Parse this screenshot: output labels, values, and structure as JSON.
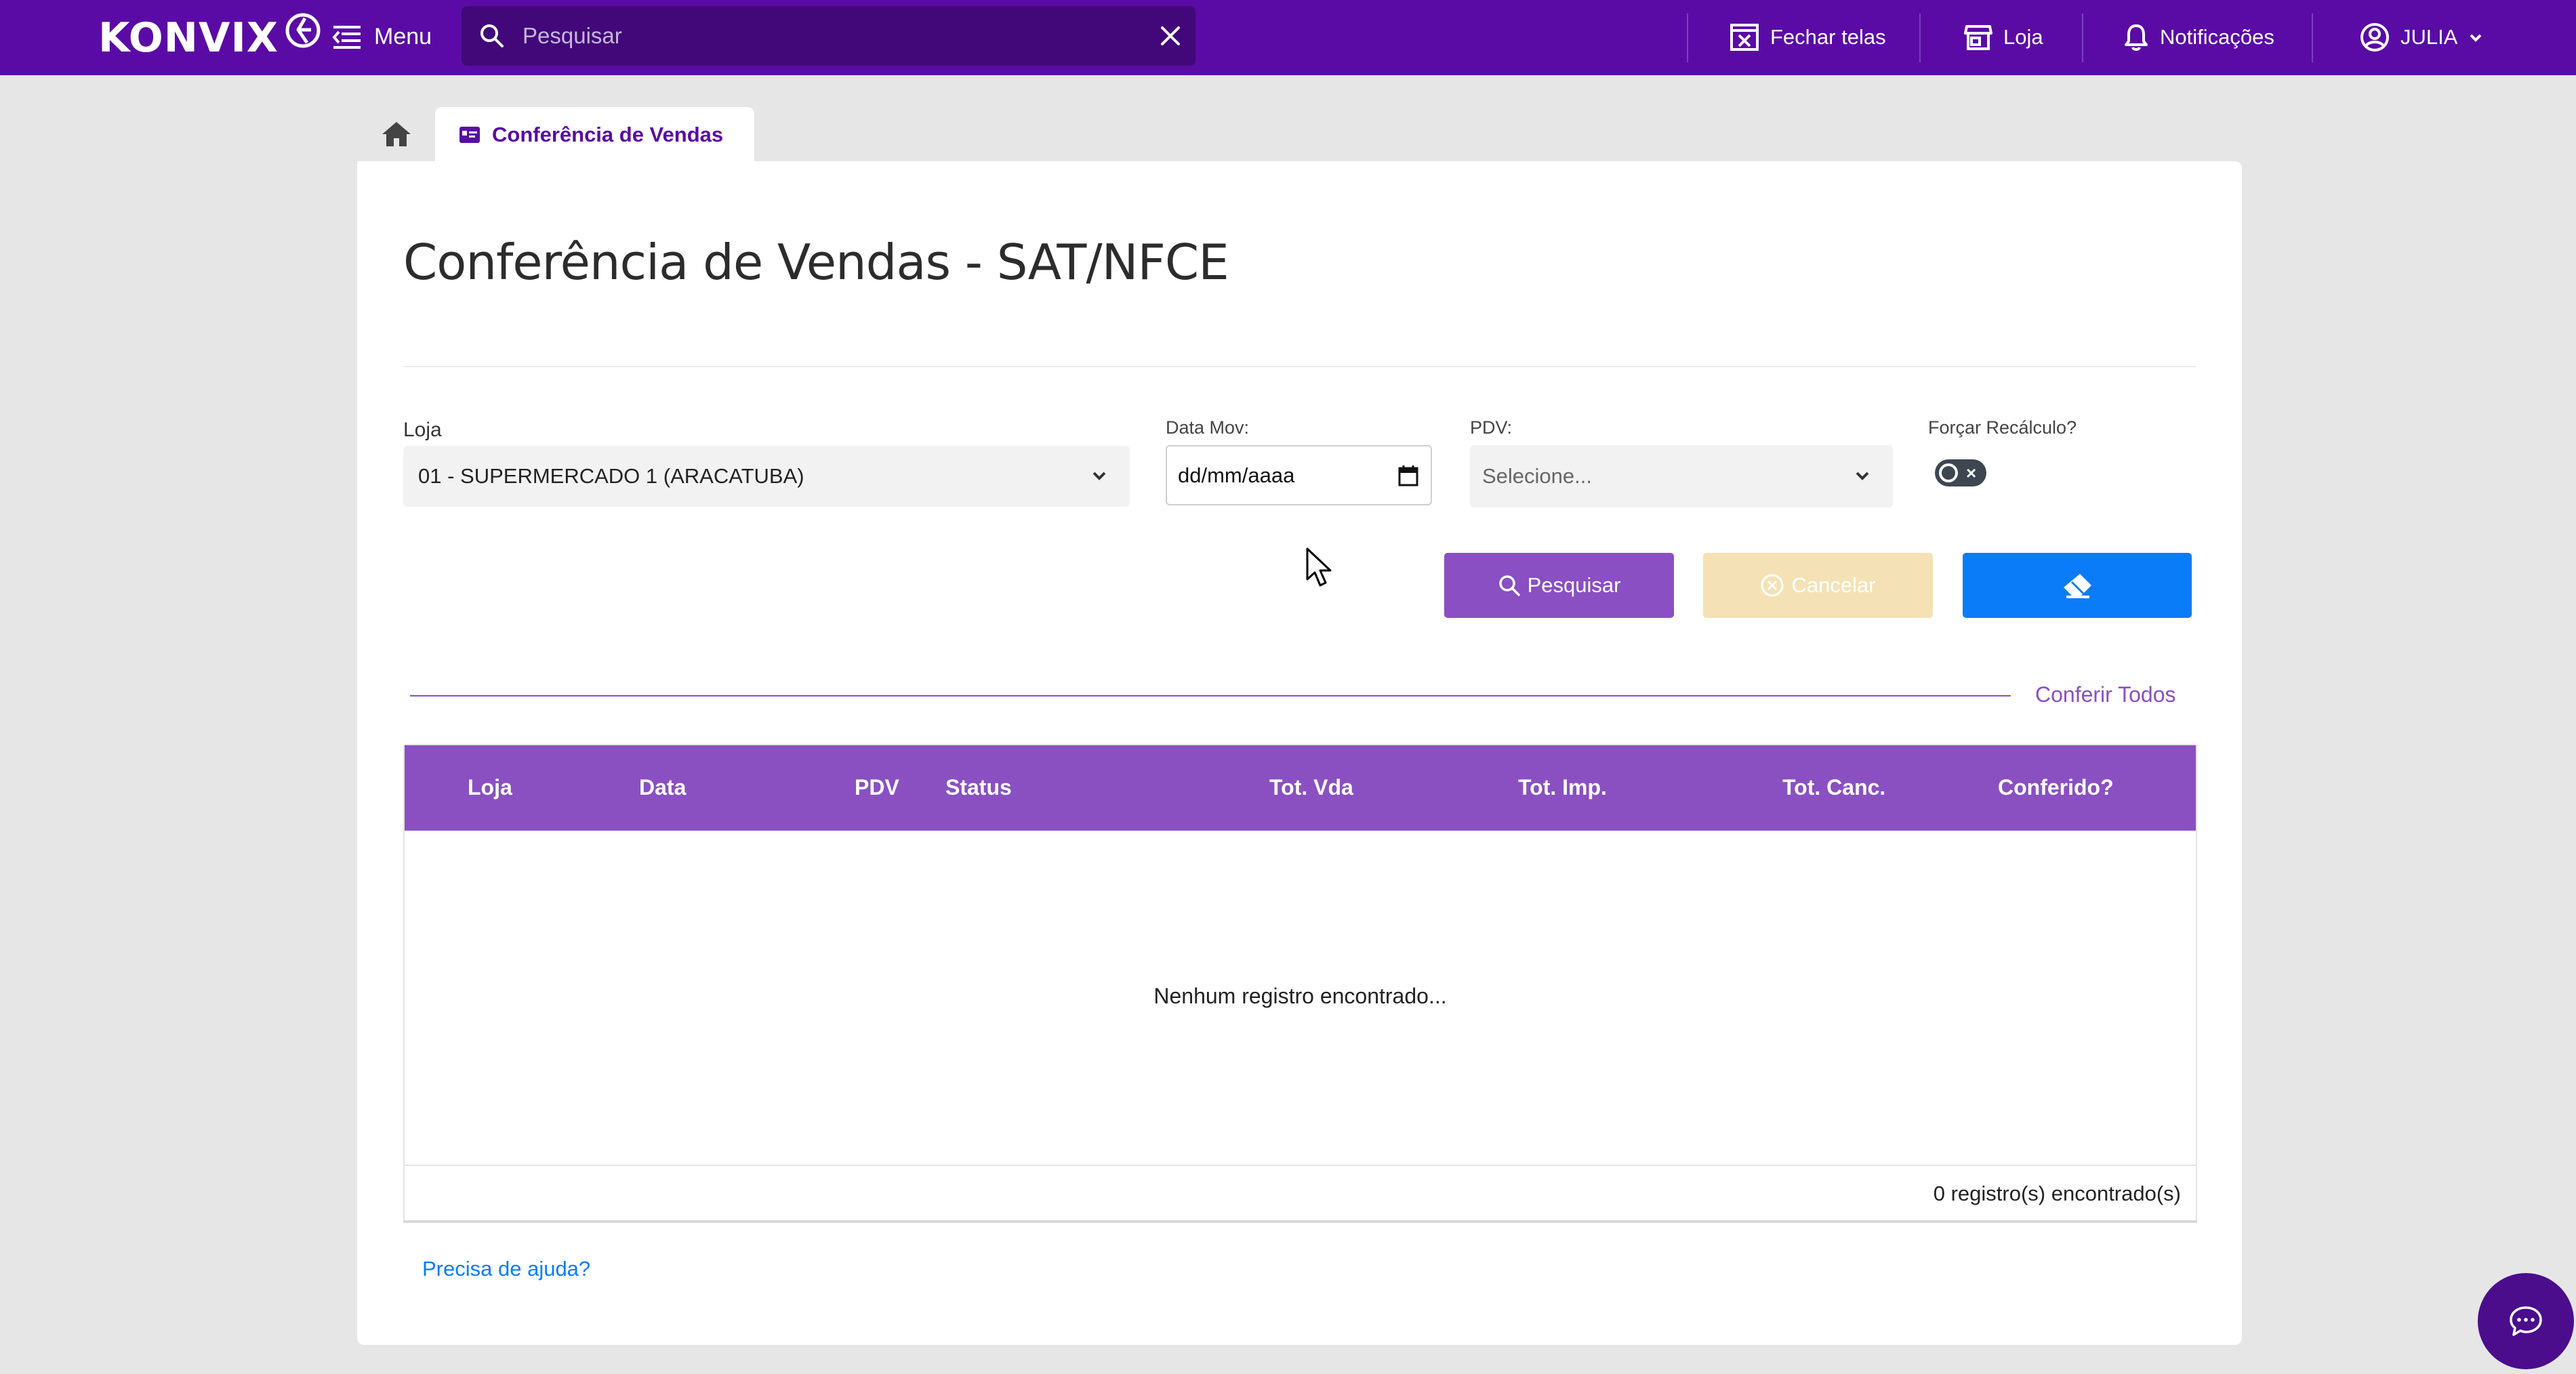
{
  "topbar": {
    "logo_text": "KONVIX",
    "menu_label": "Menu",
    "search_placeholder": "Pesquisar",
    "search_value": "",
    "close_screens_label": "Fechar telas",
    "store_label": "Loja",
    "notifications_label": "Notificações",
    "user_label": "JULIA"
  },
  "tabs": {
    "active_label": "Conferência de Vendas"
  },
  "page": {
    "title": "Conferência de Vendas - SAT/NFCE"
  },
  "form": {
    "loja_label": "Loja",
    "loja_value": "01 - SUPERMERCADO 1 (ARACATUBA)",
    "data_label": "Data Mov:",
    "data_placeholder": "dd/mm/aaaa",
    "pdv_label": "PDV:",
    "pdv_placeholder": "Selecione...",
    "recalculo_label": "Forçar Recálculo?",
    "recalculo_on": false
  },
  "buttons": {
    "search_label": "Pesquisar",
    "cancel_label": "Cancelar",
    "conferir_todos_label": "Conferir Todos"
  },
  "table": {
    "headers": [
      "Loja",
      "Data",
      "PDV",
      "Status",
      "Tot. Vda",
      "Tot. Imp.",
      "Tot. Canc.",
      "Conferido?"
    ],
    "empty_message": "Nenhum registro encontrado...",
    "footer_count": "0 registro(s) encontrado(s)"
  },
  "help_link": "Precisa de ajuda?",
  "colors": {
    "brand_purple": "#5a0ba5",
    "header_purple": "#8a50c2",
    "search_button": "#8a4fc3",
    "cancel_button": "#f4e2b6",
    "clear_button": "#0a7cf8",
    "link_blue": "#0a7cf8"
  }
}
